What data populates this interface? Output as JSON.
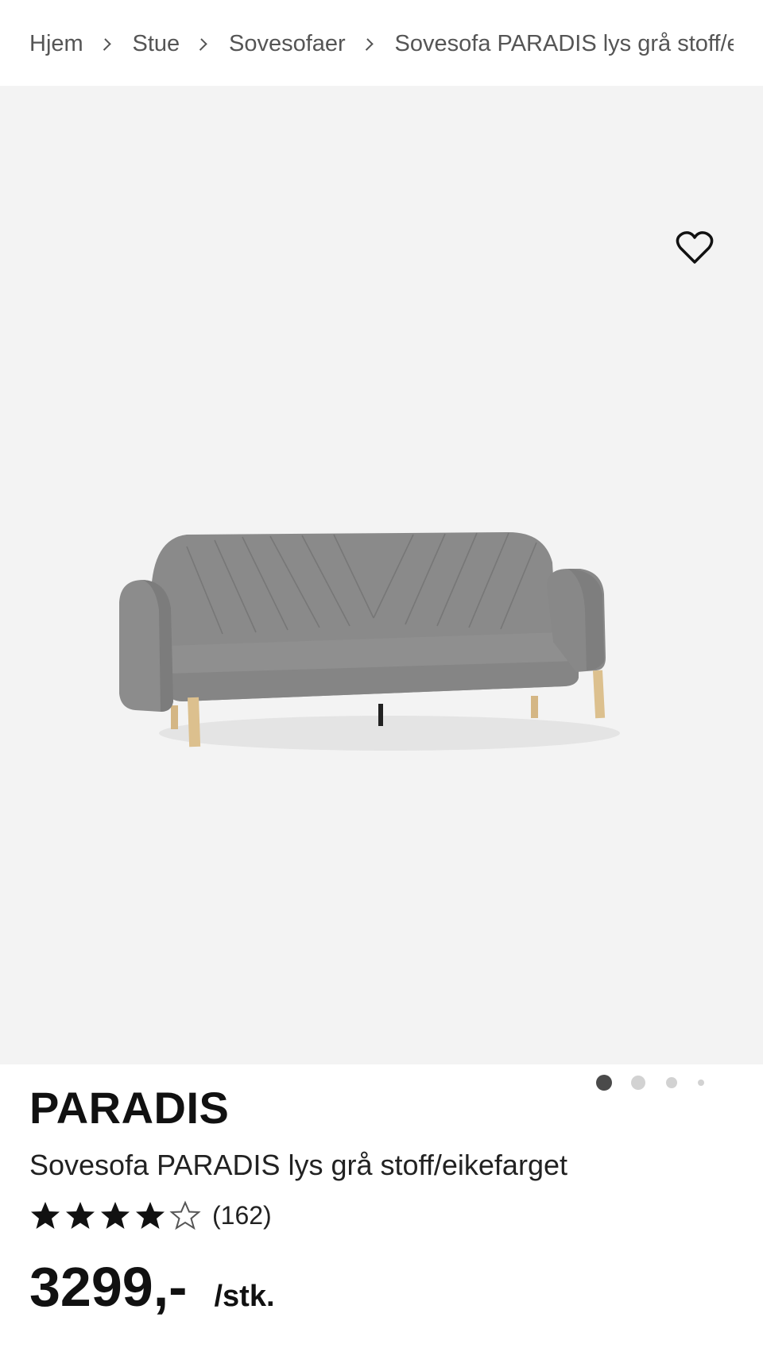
{
  "breadcrumb": {
    "items": [
      "Hjem",
      "Stue",
      "Sovesofaer"
    ],
    "current": "Sovesofa PARADIS lys grå stoff/eikefarget"
  },
  "gallery": {
    "image_subject": "grey sleeper sofa with oak-colored legs",
    "favorite_icon": "heart-icon",
    "slide_count": 4,
    "active_slide": 1
  },
  "product": {
    "brand": "PARADIS",
    "name": "Sovesofa PARADIS lys grå stoff/eikefarget",
    "rating": 4,
    "rating_max": 5,
    "review_count": "(162)",
    "price": "3299,-",
    "unit": "/stk."
  },
  "colors": {
    "gallery_bg": "#f3f3f3",
    "sofa_fabric": "#838383",
    "legs": "#dcc08e",
    "dot_active": "#4a4a4a",
    "dot_inactive": "#d2d2d2"
  }
}
